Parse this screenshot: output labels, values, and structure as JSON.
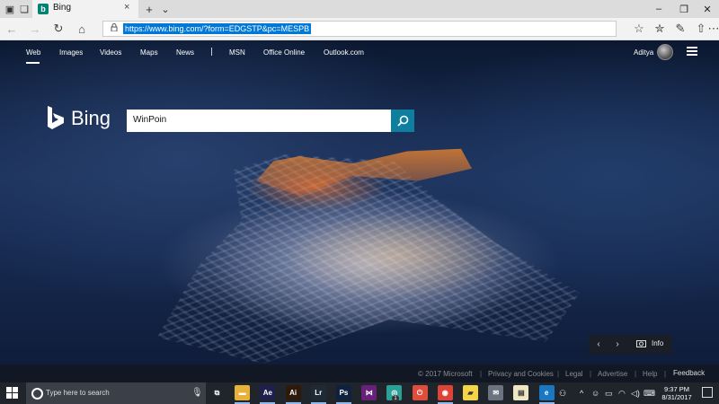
{
  "browser": {
    "tab": {
      "title": "Bing",
      "favicon": "bing-logo-icon",
      "close": "×"
    },
    "new_tab": "+",
    "tab_list": "⌄",
    "window_controls": {
      "minimize": "–",
      "maximize": "❐",
      "close": "✕"
    },
    "nav": {
      "back": "←",
      "forward": "→",
      "refresh": "↻",
      "home": "⌂"
    },
    "address": {
      "url": "https://www.bing.com/?form=EDGSTP&pc=MESPB",
      "lock_icon": "lock-icon"
    },
    "toolbar": {
      "favorite": "☆",
      "favorites_list": "✮",
      "notes": "✎",
      "share": "⇧",
      "more": "⋯"
    }
  },
  "bing": {
    "nav_links": [
      "Web",
      "Images",
      "Videos",
      "Maps",
      "News",
      "MSN",
      "Office Online",
      "Outlook.com"
    ],
    "separator": "|",
    "user_name": "Aditya",
    "logo_text": "Bing",
    "search": {
      "value": "WinPoin",
      "button_icon": "search-icon"
    },
    "image_controls": {
      "prev": "‹",
      "next": "›",
      "info_label": "Info"
    },
    "footer": {
      "copyright": "© 2017 Microsoft",
      "links": [
        "Privacy and Cookies",
        "Legal",
        "Advertise",
        "Help"
      ],
      "feedback": "Feedback"
    }
  },
  "taskbar": {
    "search_placeholder": "Type here to search",
    "apps": [
      {
        "name": "task-view-icon",
        "label": "⧉",
        "color": "#20242b"
      },
      {
        "name": "file-explorer-icon",
        "label": "▬",
        "color": "#e8b23a"
      },
      {
        "name": "after-effects-icon",
        "label": "Ae",
        "color": "#1f1f4d"
      },
      {
        "name": "illustrator-icon",
        "label": "Ai",
        "color": "#2d1a0a"
      },
      {
        "name": "lightroom-icon",
        "label": "Lr",
        "color": "#1e2a36"
      },
      {
        "name": "photoshop-icon",
        "label": "Ps",
        "color": "#0e2240"
      },
      {
        "name": "visual-studio-icon",
        "label": "⋈",
        "color": "#68217a"
      },
      {
        "name": "app-teal-icon",
        "label": "◎",
        "color": "#2aa198"
      },
      {
        "name": "app-red-icon",
        "label": "⏻",
        "color": "#e04d3c"
      },
      {
        "name": "chrome-icon",
        "label": "◉",
        "color": "#db4437"
      },
      {
        "name": "sticky-notes-icon",
        "label": "▰",
        "color": "#f5d547"
      },
      {
        "name": "app-mail-icon",
        "label": "✉",
        "color": "#6b7380"
      },
      {
        "name": "notepad-icon",
        "label": "▤",
        "color": "#efe6c2"
      },
      {
        "name": "edge-icon",
        "label": "e",
        "color": "#1a78c2"
      }
    ],
    "badge": "1",
    "tray_icons": [
      "people-icon",
      "chevron-up-icon",
      "emoji-icon",
      "battery-icon",
      "wifi-icon",
      "volume-icon",
      "keyboard-icon"
    ],
    "time": "9:37 PM",
    "date": "8/31/2017"
  },
  "colors": {
    "accent": "#0078d7",
    "bing_button": "#0f7fa0",
    "taskbar": "#20242b"
  }
}
